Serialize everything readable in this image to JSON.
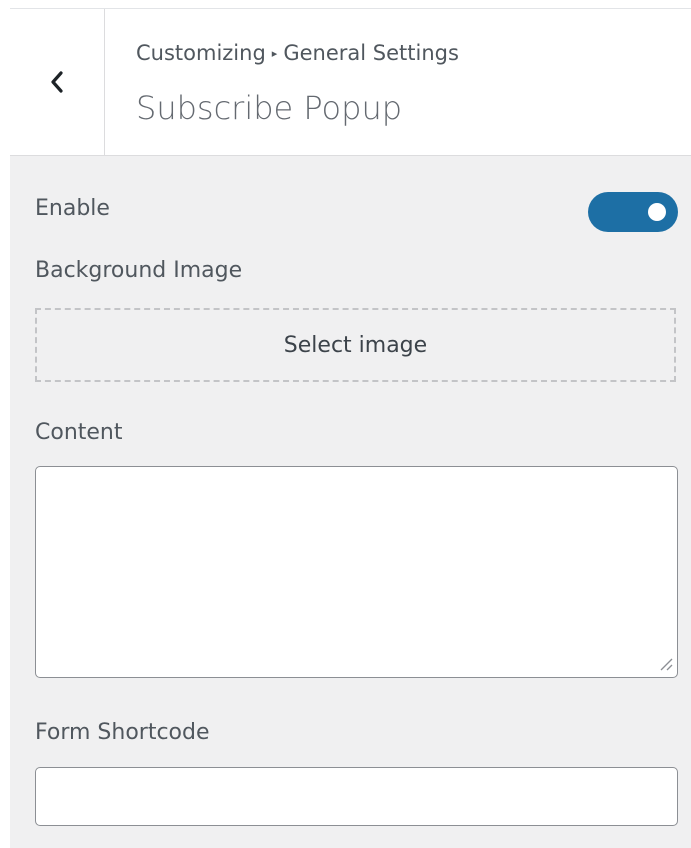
{
  "header": {
    "breadcrumb_parent": "Customizing",
    "breadcrumb_separator": "▸",
    "breadcrumb_section": "General Settings",
    "title": "Subscribe Popup",
    "back_icon": "chevron-left-icon"
  },
  "fields": {
    "enable": {
      "label": "Enable",
      "value": true,
      "accent_color": "#1d6fa5"
    },
    "background_image": {
      "label": "Background Image",
      "button_label": "Select image"
    },
    "content": {
      "label": "Content",
      "value": ""
    },
    "form_shortcode": {
      "label": "Form Shortcode",
      "value": ""
    }
  }
}
